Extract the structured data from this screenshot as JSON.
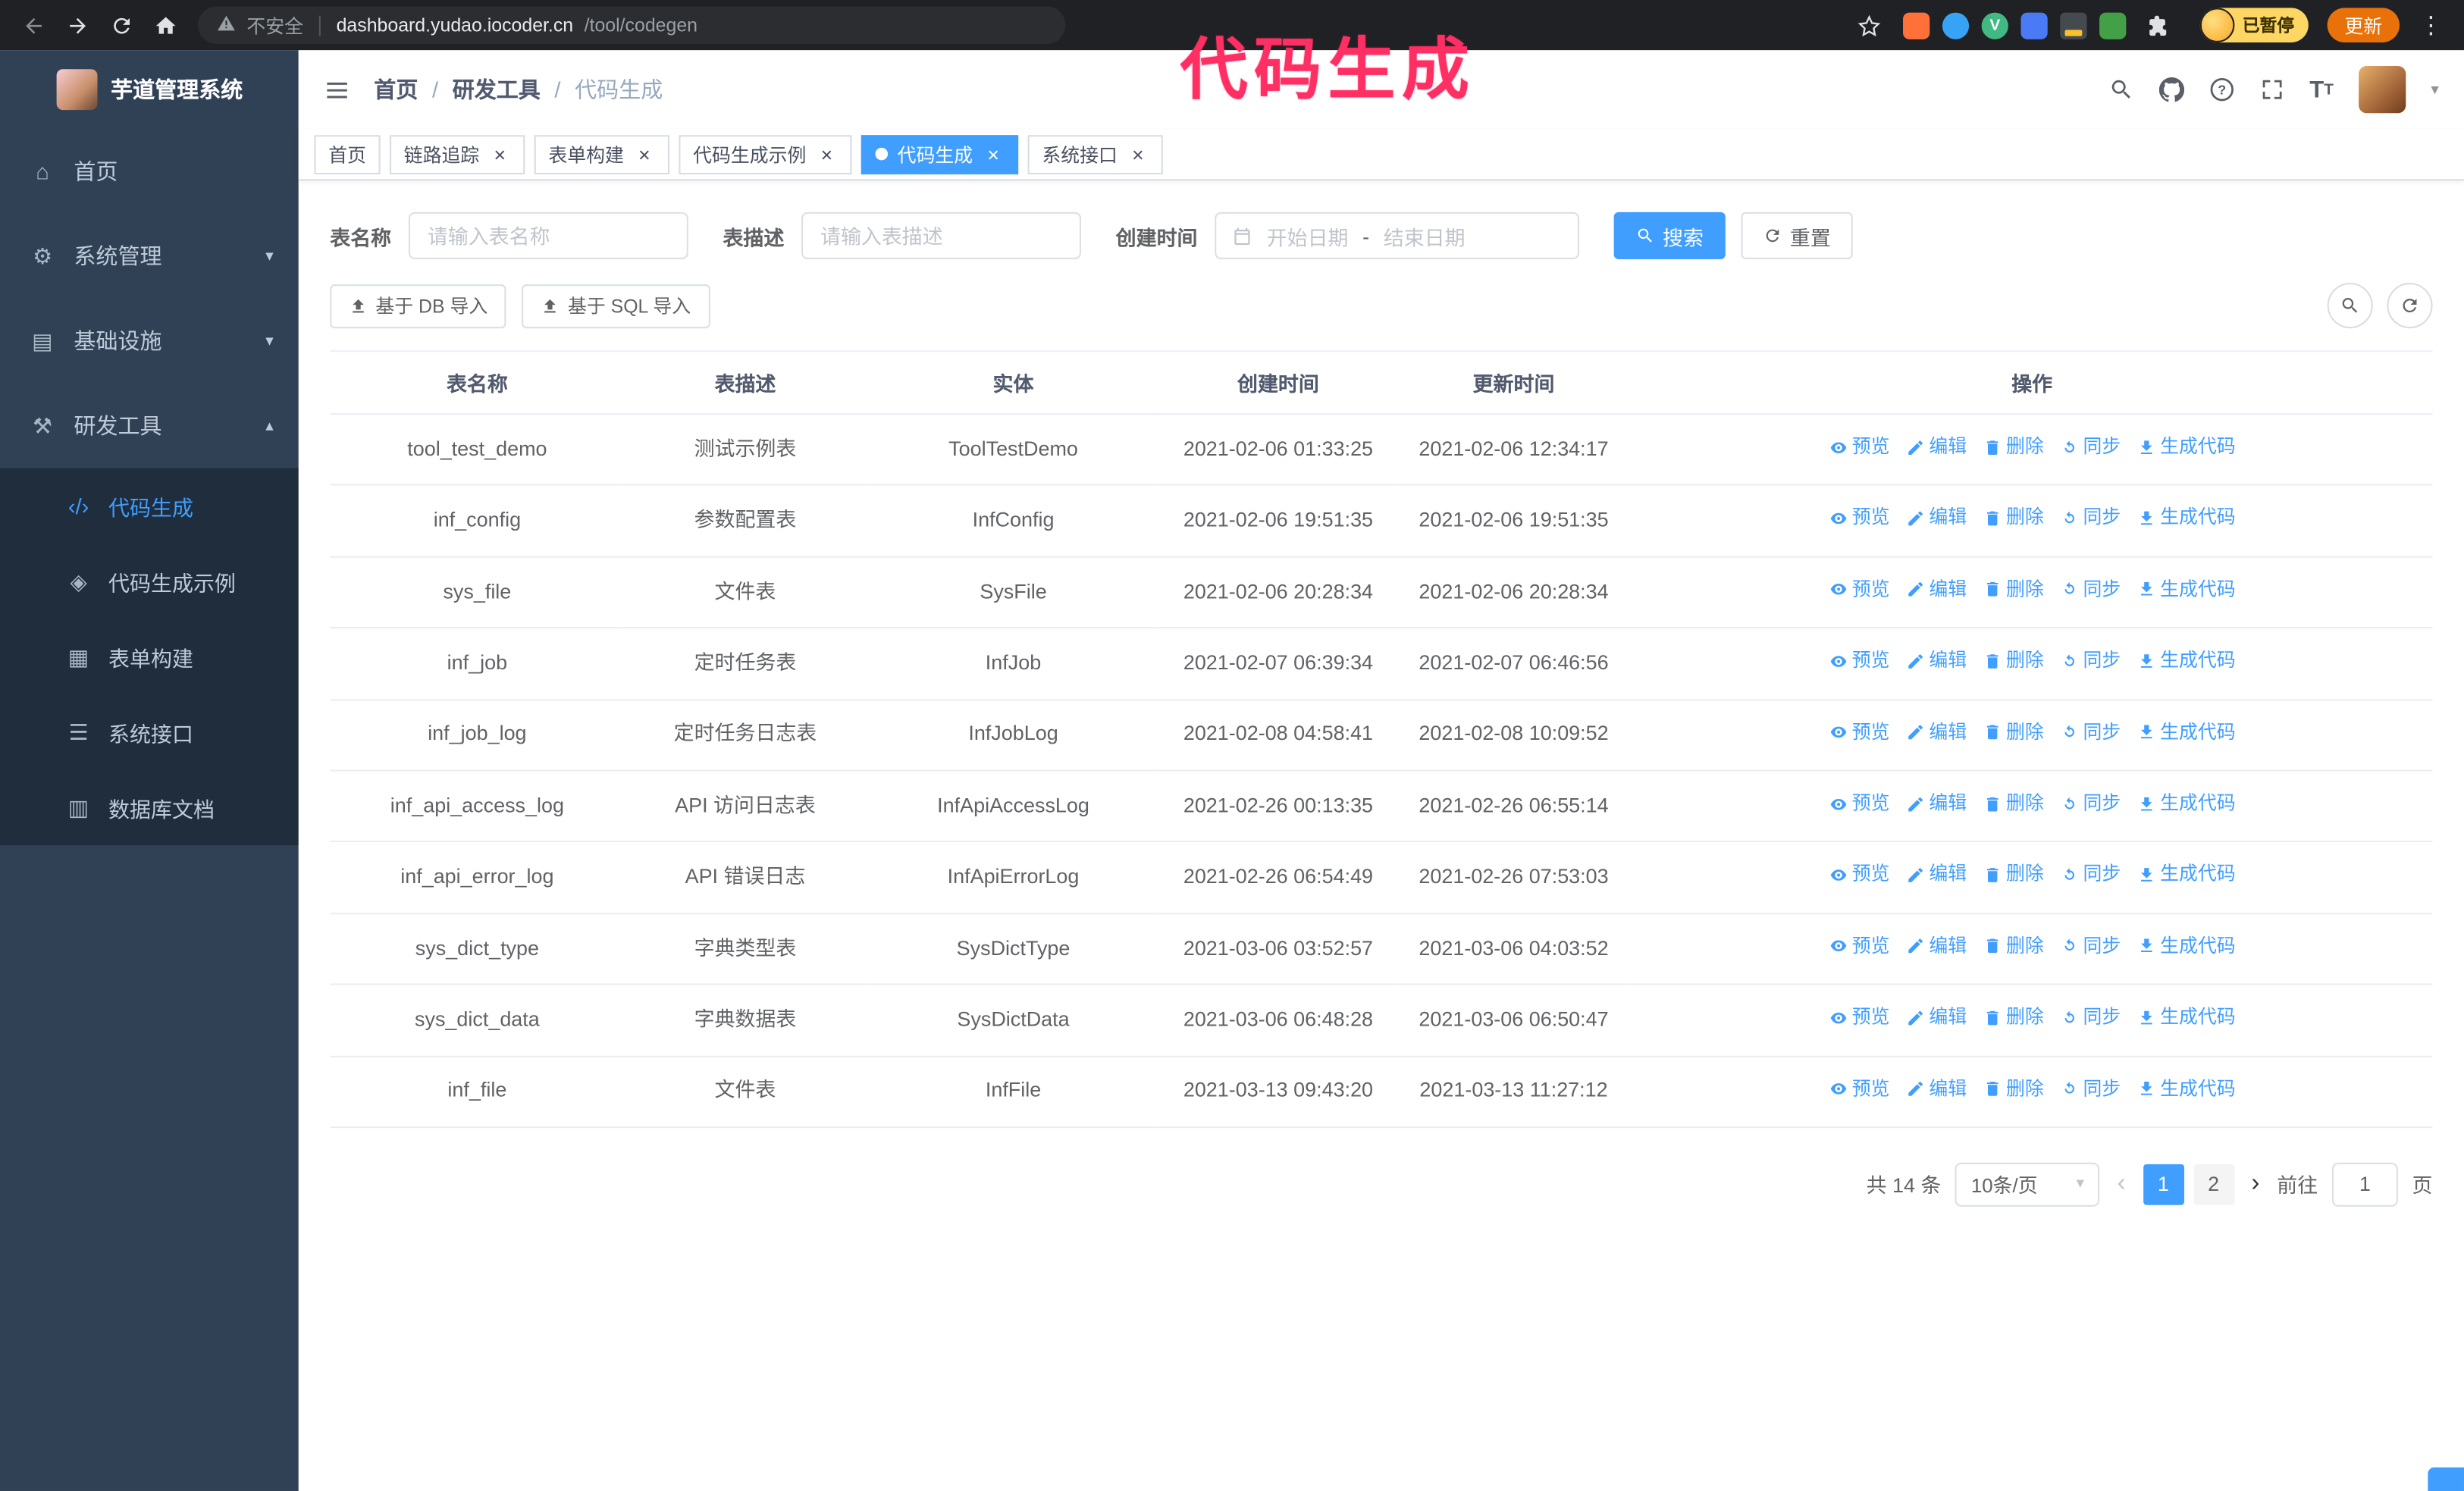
{
  "annotation": {
    "text": "代码生成"
  },
  "colors": {
    "accent": "#409eff",
    "annotation": "#ff2e63",
    "sidebar_bg": "#304156",
    "submenu_bg": "#1f2d3d",
    "update_button": "#e8710a",
    "paused_badge": "#fdd663"
  },
  "browser": {
    "security_label": "不安全",
    "host": "dashboard.yudao.iocoder.cn",
    "path": "/tool/codegen",
    "profile_status": "已暂停",
    "update_label": "更新"
  },
  "icons": {
    "home": "⌂",
    "gear": "⚙",
    "infra": "▤",
    "tools": "⚒",
    "code": "‹/›",
    "shield": "◈",
    "form": "▦",
    "sliders": "☰",
    "database": "▥"
  },
  "sidebar": {
    "title": "芋道管理系统",
    "menu": [
      {
        "key": "home",
        "label": "首页",
        "icon": "home",
        "type": "item"
      },
      {
        "key": "system",
        "label": "系统管理",
        "icon": "gear",
        "type": "group",
        "state": "collapsed"
      },
      {
        "key": "infra",
        "label": "基础设施",
        "icon": "infra",
        "type": "group",
        "state": "collapsed"
      },
      {
        "key": "devtools",
        "label": "研发工具",
        "icon": "tools",
        "type": "group",
        "state": "expanded"
      }
    ],
    "submenu": [
      {
        "key": "codegen",
        "label": "代码生成",
        "icon": "code",
        "active": true
      },
      {
        "key": "codegen-example",
        "label": "代码生成示例",
        "icon": "shield",
        "active": false
      },
      {
        "key": "form-build",
        "label": "表单构建",
        "icon": "form",
        "active": false
      },
      {
        "key": "api",
        "label": "系统接口",
        "icon": "sliders",
        "active": false
      },
      {
        "key": "db-doc",
        "label": "数据库文档",
        "icon": "database",
        "active": false
      }
    ]
  },
  "breadcrumb": [
    "首页",
    "研发工具",
    "代码生成"
  ],
  "tabs": [
    {
      "key": "home",
      "label": "首页",
      "closable": false,
      "active": false
    },
    {
      "key": "trace",
      "label": "链路追踪",
      "closable": true,
      "active": false
    },
    {
      "key": "form-build",
      "label": "表单构建",
      "closable": true,
      "active": false
    },
    {
      "key": "codegen-example",
      "label": "代码生成示例",
      "closable": true,
      "active": false
    },
    {
      "key": "codegen",
      "label": "代码生成",
      "closable": true,
      "active": true
    },
    {
      "key": "api",
      "label": "系统接口",
      "closable": true,
      "active": false
    }
  ],
  "filters": {
    "name_label": "表名称",
    "name_placeholder": "请输入表名称",
    "desc_label": "表描述",
    "desc_placeholder": "请输入表描述",
    "time_label": "创建时间",
    "start_placeholder": "开始日期",
    "range_separator": "-",
    "end_placeholder": "结束日期",
    "search_label": "搜索",
    "reset_label": "重置"
  },
  "toolbar": {
    "import_db": "基于 DB 导入",
    "import_sql": "基于 SQL 导入"
  },
  "table": {
    "columns": [
      "表名称",
      "表描述",
      "实体",
      "创建时间",
      "更新时间",
      "操作"
    ],
    "actions": [
      {
        "id": "preview",
        "label": "预览"
      },
      {
        "id": "edit",
        "label": "编辑"
      },
      {
        "id": "delete",
        "label": "删除"
      },
      {
        "id": "sync",
        "label": "同步"
      },
      {
        "id": "generate",
        "label": "生成代码"
      }
    ],
    "rows": [
      {
        "name": "tool_test_demo",
        "desc": "测试示例表",
        "entity": "ToolTestDemo",
        "created": "2021-02-06 01:33:25",
        "updated": "2021-02-06 12:34:17"
      },
      {
        "name": "inf_config",
        "desc": "参数配置表",
        "entity": "InfConfig",
        "created": "2021-02-06 19:51:35",
        "updated": "2021-02-06 19:51:35"
      },
      {
        "name": "sys_file",
        "desc": "文件表",
        "entity": "SysFile",
        "created": "2021-02-06 20:28:34",
        "updated": "2021-02-06 20:28:34"
      },
      {
        "name": "inf_job",
        "desc": "定时任务表",
        "entity": "InfJob",
        "created": "2021-02-07 06:39:34",
        "updated": "2021-02-07 06:46:56"
      },
      {
        "name": "inf_job_log",
        "desc": "定时任务日志表",
        "entity": "InfJobLog",
        "created": "2021-02-08 04:58:41",
        "updated": "2021-02-08 10:09:52"
      },
      {
        "name": "inf_api_access_log",
        "desc": "API 访问日志表",
        "entity": "InfApiAccessLog",
        "created": "2021-02-26 00:13:35",
        "updated": "2021-02-26 06:55:14"
      },
      {
        "name": "inf_api_error_log",
        "desc": "API 错误日志",
        "entity": "InfApiErrorLog",
        "created": "2021-02-26 06:54:49",
        "updated": "2021-02-26 07:53:03"
      },
      {
        "name": "sys_dict_type",
        "desc": "字典类型表",
        "entity": "SysDictType",
        "created": "2021-03-06 03:52:57",
        "updated": "2021-03-06 04:03:52"
      },
      {
        "name": "sys_dict_data",
        "desc": "字典数据表",
        "entity": "SysDictData",
        "created": "2021-03-06 06:48:28",
        "updated": "2021-03-06 06:50:47"
      },
      {
        "name": "inf_file",
        "desc": "文件表",
        "entity": "InfFile",
        "created": "2021-03-13 09:43:20",
        "updated": "2021-03-13 11:27:12"
      }
    ]
  },
  "pagination": {
    "total_text": "共 14 条",
    "page_size": "10条/页",
    "pages": [
      "1",
      "2"
    ],
    "active_page": "1",
    "goto_label": "前往",
    "goto_value": "1",
    "goto_suffix": "页"
  }
}
